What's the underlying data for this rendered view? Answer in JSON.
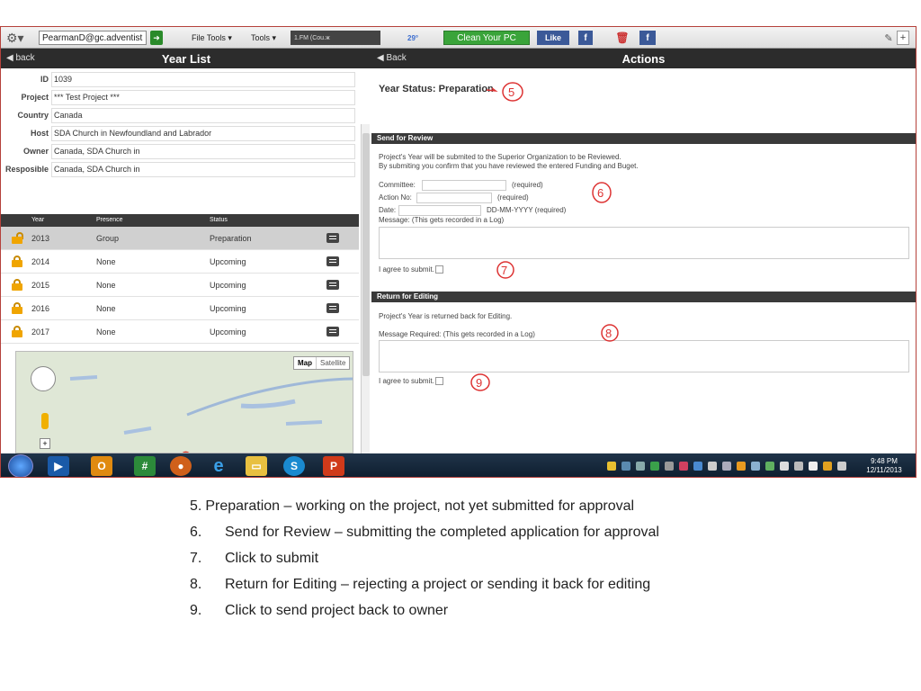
{
  "browser_toolbar": {
    "email": "PearmanD@gc.adventist",
    "file_tools": "File Tools",
    "tools": "Tools",
    "radio": "1.FM (Cou.ж",
    "weather": "29°",
    "clean_button": "Clean Your PC",
    "like_button": "Like",
    "facebook_letter": "f"
  },
  "left_panel": {
    "back_label": "back",
    "title": "Year List",
    "fields": [
      {
        "label": "ID",
        "value": "1039"
      },
      {
        "label": "Project",
        "value": "*** Test Project ***"
      },
      {
        "label": "Country",
        "value": "Canada"
      },
      {
        "label": "Host",
        "value": "SDA Church in Newfoundland and Labrador"
      },
      {
        "label": "Owner",
        "value": "Canada, SDA Church in"
      },
      {
        "label": "Resposible",
        "value": "Canada, SDA Church in"
      }
    ],
    "table_headers": [
      "Year",
      "Presence",
      "Status"
    ],
    "rows": [
      {
        "year": "2013",
        "presence": "Group",
        "status": "Preparation"
      },
      {
        "year": "2014",
        "presence": "None",
        "status": "Upcoming"
      },
      {
        "year": "2015",
        "presence": "None",
        "status": "Upcoming"
      },
      {
        "year": "2016",
        "presence": "None",
        "status": "Upcoming"
      },
      {
        "year": "2017",
        "presence": "None",
        "status": "Upcoming"
      }
    ],
    "map_type": [
      "Map",
      "Satellite"
    ]
  },
  "right_panel": {
    "back_label": "Back",
    "title": "Actions",
    "year_status": "Year Status: Preparation",
    "send_for_review": {
      "heading": "Send for Review",
      "line1": "Project's Year will be submited to the Superior Organization to be Reviewed.",
      "line2": "By submiting you confirm that you have reviewed the entered Funding and Buget.",
      "committee_label": "Committee:",
      "committee_req": "(required)",
      "action_label": "Action No:",
      "action_req": "(required)",
      "date_label": "Date:",
      "date_req": "DD-MM-YYYY (required)",
      "message_label": "Message: (This gets recorded in a Log)",
      "agree_label": "I agree to submit."
    },
    "return_for_editing": {
      "heading": "Return for Editing",
      "line1": "Project's Year is returned back for Editing.",
      "message_label": "Message Required: (This gets recorded in a Log)",
      "agree_label": "I agree to submit."
    },
    "annotations": [
      "5",
      "6",
      "7",
      "8",
      "9"
    ]
  },
  "taskbar": {
    "time": "9:48 PM",
    "date": "12/11/2013"
  },
  "notes": [
    {
      "num": "5.",
      "text": "Preparation – working on the project, not yet submitted for approval"
    },
    {
      "num": "6.",
      "text": "Send for Review – submitting the completed application for approval"
    },
    {
      "num": "7.",
      "text": "Click to submit"
    },
    {
      "num": "8.",
      "text": "Return for Editing – rejecting a project or sending it back for editing"
    },
    {
      "num": "9.",
      "text": "Click to send project back to owner"
    }
  ]
}
